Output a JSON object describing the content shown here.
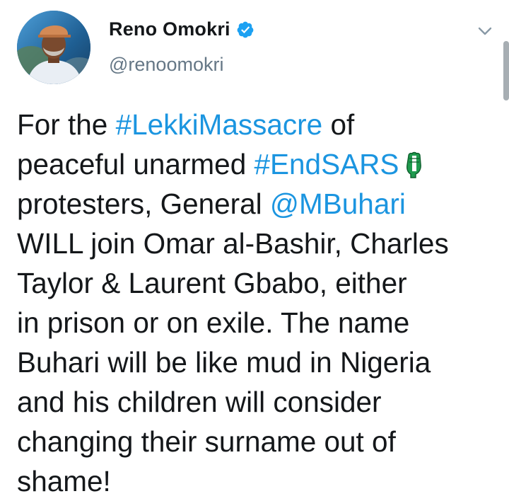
{
  "author": {
    "display_name": "Reno Omokri",
    "handle": "@renoomokri",
    "verified": true,
    "avatar_icon": "profile-photo"
  },
  "tweet": {
    "line1_pre": "For the ",
    "hashtag1": "#LekkiMassacre",
    "line1_post": " of",
    "line2_pre": "peaceful unarmed ",
    "hashtag2": "#EndSARS",
    "emoji_icon": "raised-fist-nigeria-icon",
    "line3_pre": "protesters, General ",
    "mention": "@MBuhari",
    "line4": "WILL join Omar al-Bashir, Charles",
    "line5": "Taylor & Laurent Gbabo, either",
    "line6": "in prison or on exile. The name",
    "line7": "Buhari will be like mud in Nigeria",
    "line8": "and his children will consider",
    "line9": "changing their surname out of",
    "line10": "shame!"
  },
  "colors": {
    "link": "#1b95e0",
    "text": "#14171a",
    "secondary": "#657786",
    "verified_badge": "#1da1f2"
  }
}
